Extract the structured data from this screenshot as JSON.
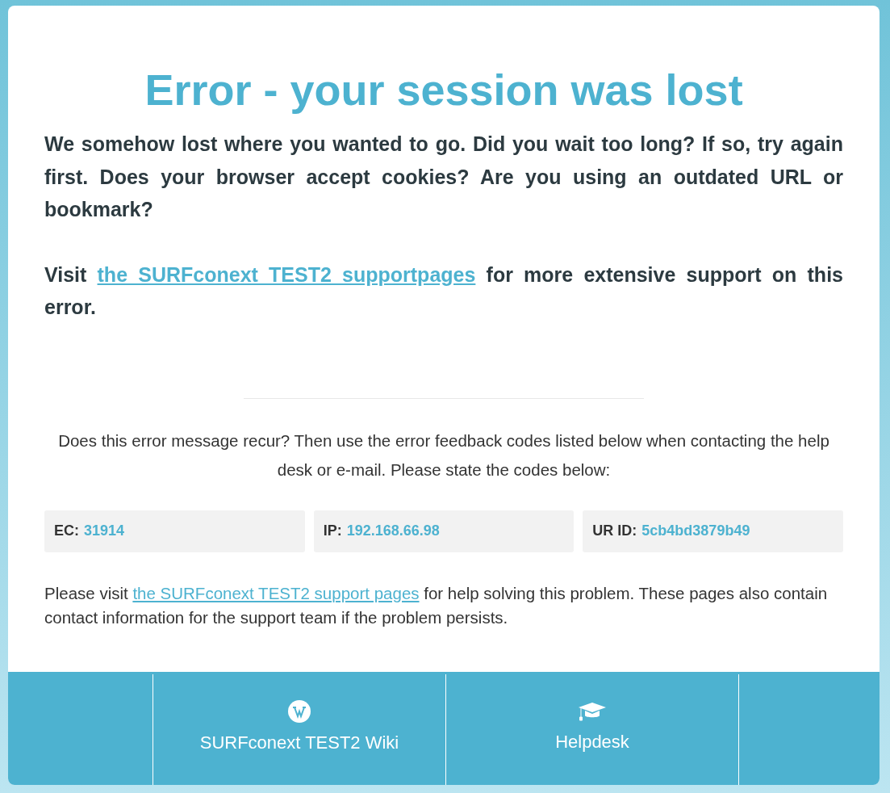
{
  "title": "Error - your session was lost",
  "intro": "We somehow lost where you wanted to go. Did you wait too long? If so, try again first. Does your browser accept cookies? Are you using an outdated URL or bookmark?",
  "visit": {
    "before": "Visit",
    "link": "the SURFconext TEST2 supportpages",
    "after": "for more extensive support on this error."
  },
  "recur_text": "Does this error message recur? Then use the error feedback codes listed below when contacting the help desk or e-mail. Please state the codes below:",
  "codes": [
    {
      "label": "EC:",
      "value": "31914"
    },
    {
      "label": "IP:",
      "value": "192.168.66.98"
    },
    {
      "label": "UR ID:",
      "value": "5cb4bd3879b49"
    }
  ],
  "help": {
    "before": "Please visit",
    "link": "the SURFconext TEST2 support pages",
    "after": "for help solving this problem. These pages also contain contact information for the support team if the problem persists."
  },
  "footer_links": [
    {
      "kind": "wiki",
      "label": "SURFconext TEST2 Wiki"
    },
    {
      "kind": "helpdesk",
      "label": "Helpdesk"
    }
  ]
}
